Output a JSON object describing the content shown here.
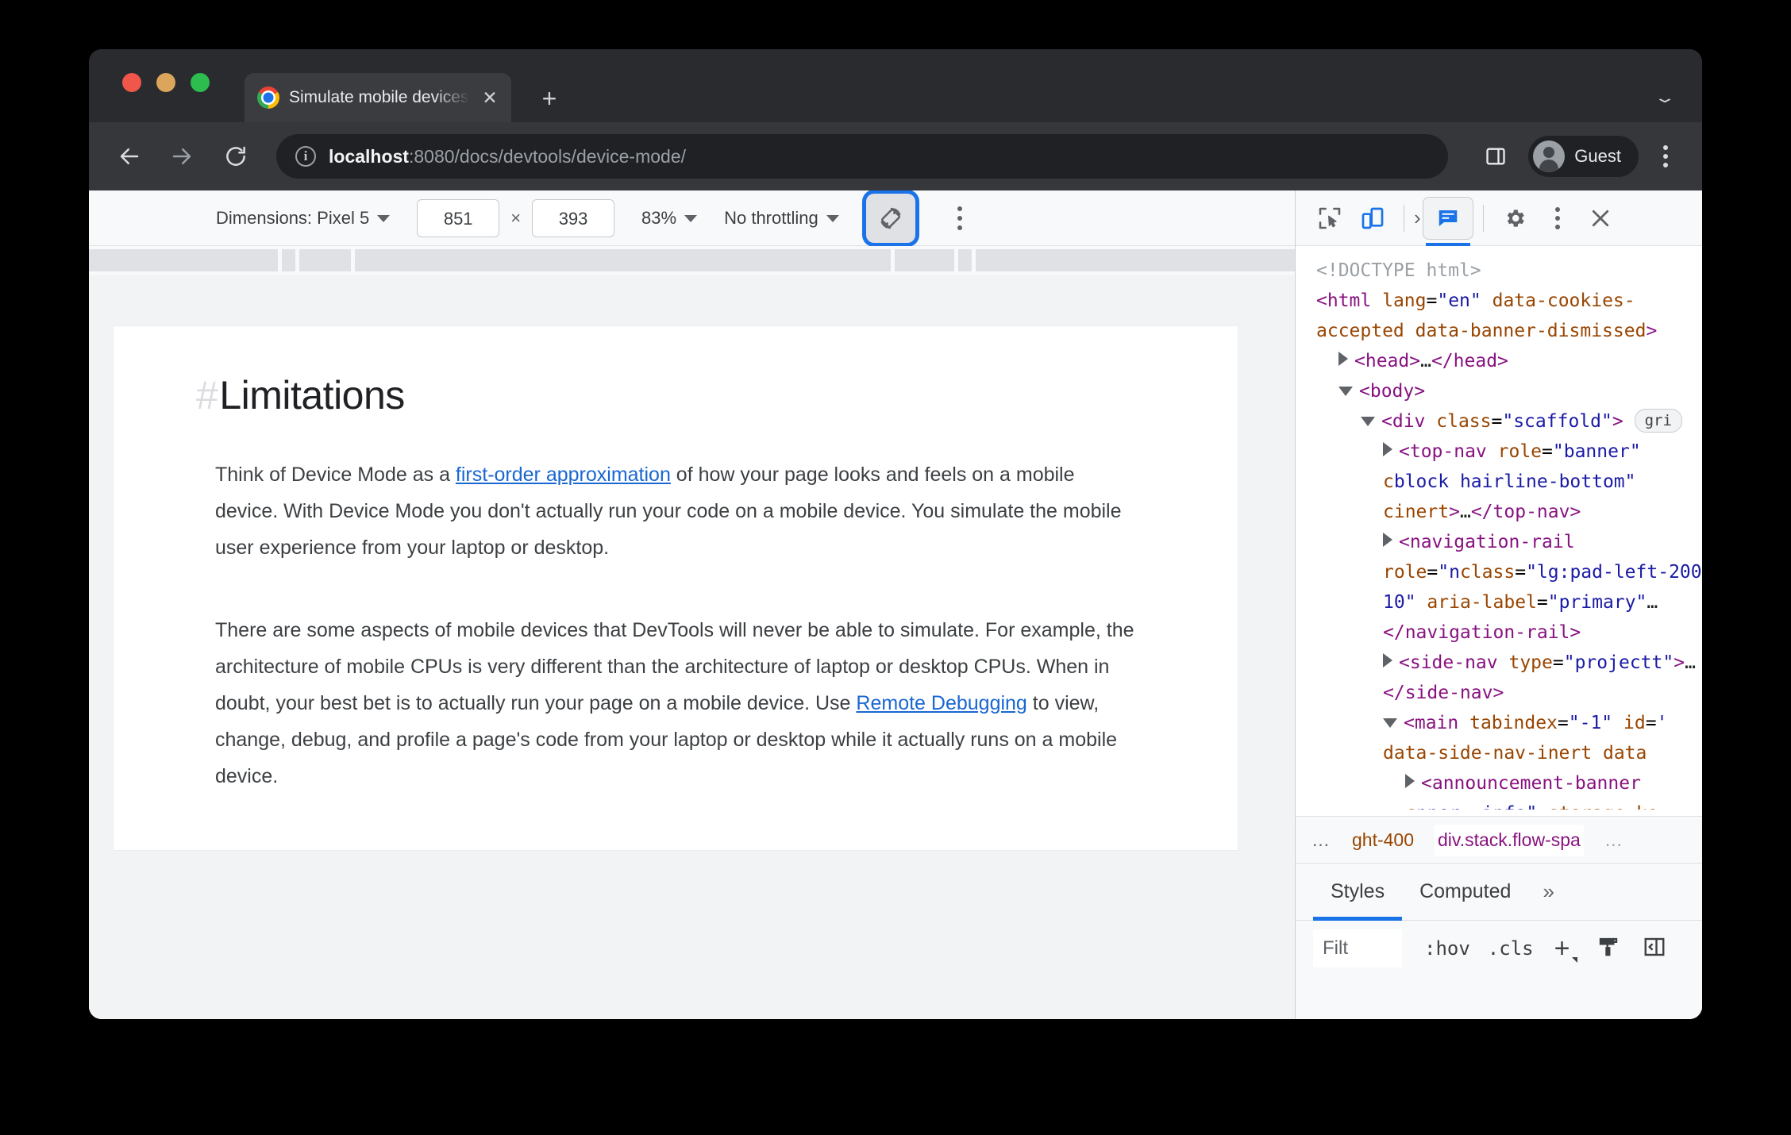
{
  "window": {
    "traffic_lights": [
      "close",
      "minimize",
      "maximize"
    ],
    "chevron": "⌄"
  },
  "tab": {
    "title": "Simulate mobile devices with D",
    "close_label": "✕",
    "newtab_label": "+",
    "favicon": "chrome-logo-icon"
  },
  "toolbar": {
    "back_label": "Back",
    "forward_label": "Forward",
    "reload_label": "Reload",
    "url_secure_part": "localhost",
    "url_rest": ":8080/docs/devtools/device-mode/",
    "profile_name": "Guest",
    "info_glyph": "i"
  },
  "device_toolbar": {
    "dimensions_label": "Dimensions: Pixel 5",
    "width_value": "851",
    "multiply_symbol": "×",
    "height_value": "393",
    "zoom_value": "83%",
    "throttling_label": "No throttling",
    "rotate_label": "Rotate",
    "more_options_label": "More options",
    "highlight_color": "#1a73e8"
  },
  "page": {
    "heading_hash": "#",
    "heading": "Limitations",
    "paragraph1_before_link": "Think of Device Mode as a ",
    "paragraph1_link": "first-order approximation",
    "paragraph1_after_link": " of how your page looks and feels on a mobile device. With Device Mode you don't actually run your code on a mobile device. You simulate the mobile user experience from your laptop or desktop.",
    "paragraph2_before_link": "There are some aspects of mobile devices that DevTools will never be able to simulate. For example, the architecture of mobile CPUs is very different than the architecture of laptop or desktop CPUs. When in doubt, your best bet is to actually run your page on a mobile device. Use ",
    "paragraph2_link": "Remote Debugging",
    "paragraph2_after_link": " to view, change, debug, and profile a page's code from your laptop or desktop while it actually runs on a mobile device.",
    "link_color": "#1967d2"
  },
  "devtools": {
    "icons": {
      "inspect": "inspect-element-icon",
      "device_toggle": "toggle-device-toolbar-icon",
      "chevron": "›",
      "console_panel": "console-message-icon",
      "settings": "gear-icon",
      "more": "more-options-icon",
      "close": "✕"
    },
    "dom_lines": [
      {
        "indent": 0,
        "arrow": "none",
        "html": "<span class=\"tok-doctype\">&lt;!DOCTYPE html&gt;</span>"
      },
      {
        "indent": 0,
        "arrow": "none",
        "html": "<span class=\"tok-tag\">&lt;html</span> <span class=\"tok-attr\">lang</span>=<span class=\"tok-val\">\"en\"</span> <span class=\"tok-attr\">data-cookies-accepted</span> <span class=\"tok-attr\">data-banner-dismissed</span><span class=\"tok-tag\">&gt;</span>"
      },
      {
        "indent": 1,
        "arrow": "closed",
        "html": "<span class=\"tok-tag\">&lt;head&gt;</span><span class=\"tok-dots\">…</span><span class=\"tok-tag\">&lt;/head&gt;</span>"
      },
      {
        "indent": 1,
        "arrow": "open",
        "html": "<span class=\"tok-tag\">&lt;body&gt;</span>"
      },
      {
        "indent": 2,
        "arrow": "open",
        "html": "<span class=\"tok-tag\">&lt;div</span> <span class=\"tok-attr\">class</span>=<span class=\"tok-val\">\"scaffold\"</span><span class=\"tok-tag\">&gt;</span> <span class=\"badge-grid\">gri</span>"
      },
      {
        "indent": 3,
        "arrow": "closed",
        "html": "<span class=\"tok-tag\">&lt;top-nav</span> <span class=\"tok-attr\">role</span>=<span class=\"tok-val\">\"banner\"</span> <span class=\"tok-attr\">c</span><span class=\"tok-val\">block hairline-bottom\"</span> <span class=\"tok-attr\">c</span><span class=\"tok-attr\">inert</span><span class=\"tok-tag\">&gt;</span><span class=\"tok-dots\">…</span><span class=\"tok-tag\">&lt;/top-nav&gt;</span>"
      },
      {
        "indent": 3,
        "arrow": "closed",
        "html": "<span class=\"tok-tag\">&lt;navigation-rail</span> <span class=\"tok-attr\">role</span>=<span class=\"tok-val\">\"n</span><span class=\"tok-attr\">class</span>=<span class=\"tok-val\">\"lg:pad-left-200 1</span><span class=\"tok-val\">0\"</span> <span class=\"tok-attr\">aria-label</span>=<span class=\"tok-val\">\"primary\"</span><span class=\"tok-dots\">…</span><span class=\"tok-tag\">&lt;/navigation-rail&gt;</span>"
      },
      {
        "indent": 3,
        "arrow": "closed",
        "html": "<span class=\"tok-tag\">&lt;side-nav</span> <span class=\"tok-attr\">type</span>=<span class=\"tok-val\">\"project</span><span class=\"tok-val\">t\"</span><span class=\"tok-tag\">&gt;</span><span class=\"tok-dots\">…</span><span class=\"tok-tag\">&lt;/side-nav&gt;</span>"
      },
      {
        "indent": 3,
        "arrow": "open",
        "html": "<span class=\"tok-tag\">&lt;main</span> <span class=\"tok-attr\">tabindex</span>=<span class=\"tok-val\">\"-1\"</span> <span class=\"tok-attr\">id</span>=<span class=\"tok-val\">'</span> <span class=\"tok-attr\">data-side-nav-inert</span> <span class=\"tok-attr\">data</span>"
      },
      {
        "indent": 4,
        "arrow": "closed",
        "html": "<span class=\"tok-tag\">&lt;announcement-banner</span> <span class=\"tok-attr\">c</span><span class=\"tok-val\">nner--info\"</span> <span class=\"tok-attr\">storage-ke</span>"
      }
    ],
    "breadcrumb": {
      "left_ellipsis": "…",
      "items": [
        "ght-400",
        "div.stack.flow-spa"
      ],
      "right_ellipsis": "…"
    },
    "styles_tabs": [
      {
        "label": "Styles",
        "active": true
      },
      {
        "label": "Computed",
        "active": false
      }
    ],
    "styles_more": "»",
    "filter_text": "Filt",
    "hov_label": ":hov",
    "cls_label": ".cls",
    "plus_label": "+",
    "new_style_rule_label": "new-style-rule-icon",
    "dock_label": "dock-to-left-icon"
  },
  "ruler_ticks": [
    238,
    260,
    360,
    1106,
    1128,
    1146
  ],
  "colors": {
    "accent_blue": "#1a73e8",
    "chrome_dark": "#292b2f",
    "toolbar_dark": "#35373b",
    "omnibox_dark": "#202124",
    "devtools_bg": "#f8f9fa"
  }
}
